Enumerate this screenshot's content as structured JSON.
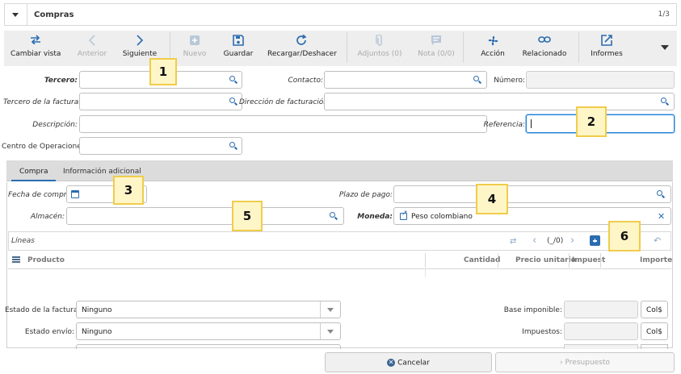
{
  "window": {
    "title": "Compras",
    "record_count": "1/3"
  },
  "toolbar": {
    "change_view": "Cambiar vista",
    "previous": "Anterior",
    "next": "Siguiente",
    "new": "Nuevo",
    "save": "Guardar",
    "reload": "Recargar/Deshacer",
    "attachments": "Adjuntos (0)",
    "note": "Nota (0/0)",
    "action": "Acción",
    "related": "Relacionado",
    "reports": "Informes"
  },
  "form": {
    "party_label": "Tercero:",
    "contact_label": "Contacto:",
    "number_label": "Número:",
    "invoice_party_label": "Tercero de la factura:",
    "invoice_address_label": "Dirección de facturación:",
    "description_label": "Descripción:",
    "reference_label": "Referencia:",
    "operation_center_label": "Centro de Operaciones:"
  },
  "tabs": [
    {
      "label": "Compra",
      "active": true
    },
    {
      "label": "Información adicional",
      "active": false
    }
  ],
  "purchase_tab": {
    "purchase_date_label": "Fecha de compra:",
    "payment_term_label": "Plazo de pago:",
    "warehouse_label": "Almacén:",
    "currency_label": "Moneda:",
    "currency_value": "Peso colombiano"
  },
  "lines": {
    "title": "Líneas",
    "pager": "(_/0)",
    "columns": [
      "Producto",
      "Cantidad",
      "Precio unitario",
      "Impuest",
      "Importe"
    ]
  },
  "summary": {
    "invoice_state_label": "Estado de la factura:",
    "invoice_state_value": "Ninguno",
    "shipment_state_label": "Estado envío:",
    "shipment_state_value": "Ninguno",
    "untaxed_label": "Base imponible:",
    "untaxed_currency": "Col$",
    "tax_label": "Impuestos:",
    "tax_currency": "Col$"
  },
  "footer": {
    "cancel": "Cancelar",
    "quote": "Presupuesto"
  },
  "markers": [
    "1",
    "2",
    "3",
    "4",
    "5",
    "6"
  ],
  "colors": {
    "accent": "#2b6cb0",
    "marker_border": "#f0cc4a",
    "marker_fill": "#fff6c8",
    "toolbar_bg": "#eeeeee"
  }
}
